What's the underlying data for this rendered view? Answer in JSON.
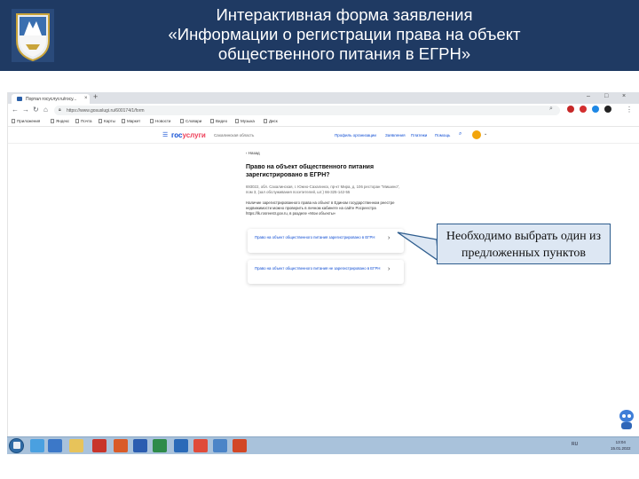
{
  "slide": {
    "title_lines": [
      "Интерактивная форма заявления",
      "«Информации о регистрации права на объект",
      "общественного питания в ЕГРН»"
    ]
  },
  "browser": {
    "tab_title": "Портал госуслуг.ru/госу...",
    "tab_close": "×",
    "new_tab": "+",
    "url": "https://www.gosuslugi.ru/600174/1/form",
    "bookmarks": [
      "Приложения",
      "Яндекс",
      "Почта",
      "Карты",
      "Маркет",
      "Новости",
      "Словари",
      "Видео",
      "Музыка",
      "Диск"
    ]
  },
  "gosuslugi": {
    "logo_main": "гос",
    "logo_accent": "услуги",
    "region": "Сахалинская область",
    "nav": [
      "Профиль организации",
      "Заявления",
      "Платежи",
      "Помощь"
    ],
    "back": "‹ Назад",
    "question": "Право на объект общественного питания зарегистрировано в ЕГРН?",
    "address": "693022, обл. Сахалинская, г. Южно-Сахалинск, пр-кт Мира, д. 106 ресторан \"Мишино\", пом 3, (зал обслуживания посетителей, шт.) 66-325-142-55",
    "note": "Наличие зарегистрированного права на объект в Едином государственном реестре недвижимости можно проверить в личном кабинете на сайте Росреестра https://lk.rosreestr.gov.ru, в разделе «Мои объекты»",
    "options": [
      "Право на объект общественного питания зарегистрировано в ЕГРН",
      "Право на объект общественного питания не зарегистрировано в ЕГРН"
    ]
  },
  "callout": {
    "line1": "Необходимо выбрать один из",
    "line2": "предложенных пунктов"
  },
  "taskbar": {
    "tray": "RU",
    "time": "13:04",
    "date": "15.01.2022"
  },
  "colors": {
    "header_bg": "#1f3a63",
    "gos_blue": "#0d4cd3",
    "gos_red": "#ee3f58",
    "callout_bg": "#dde7f3",
    "callout_border": "#2e5d8e"
  }
}
